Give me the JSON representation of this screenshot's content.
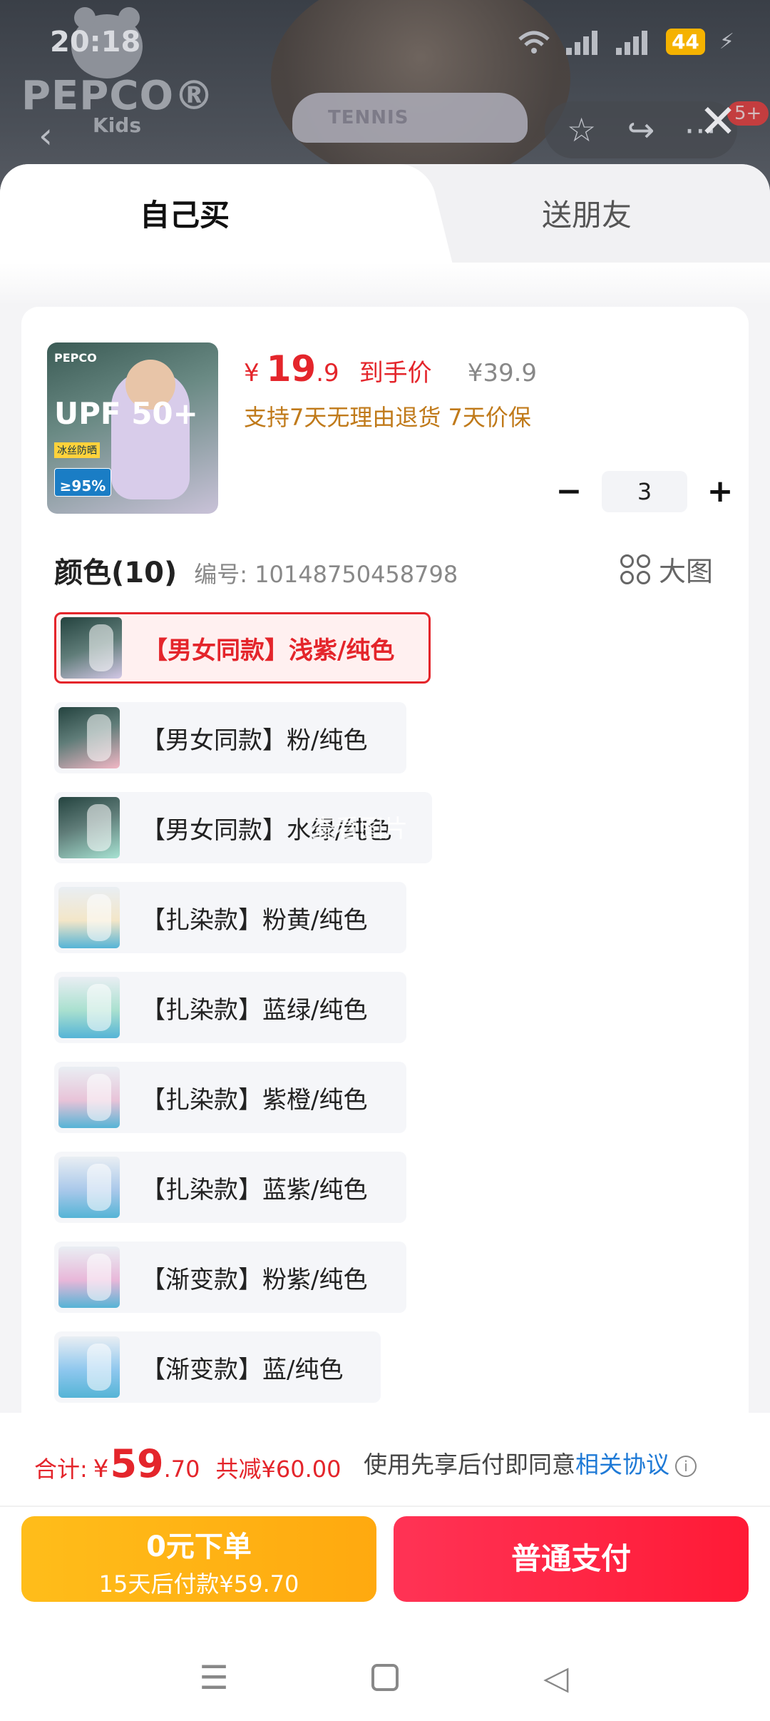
{
  "status_bar": {
    "time": "20:18",
    "battery": "44"
  },
  "brand": {
    "name": "PEPCO®",
    "sub": "Kids"
  },
  "backdrop_text": "TENNIS",
  "nav": {
    "badge": "5+"
  },
  "tabs": {
    "self_buy": "自己买",
    "gift": "送朋友"
  },
  "product": {
    "image_logo": "PEPCO",
    "image_upf": "UPF 50+",
    "image_tag1": "冰丝防晒",
    "image_tag2": "≥95%",
    "price_currency": "¥",
    "price_int": "19",
    "price_dec": ".9",
    "price_tag": "到手价",
    "price_old": "¥39.9",
    "service": "支持7天无理由退货  7天价保",
    "quantity": "3"
  },
  "section": {
    "title": "颜色(10)",
    "code": "编号: 10148750458798",
    "bigpic": "大图"
  },
  "options": [
    {
      "label": "【男女同款】浅紫/纯色",
      "selected": true
    },
    {
      "label": "【男女同款】粉/纯色"
    },
    {
      "label": "【男女同款】水绿/纯色"
    },
    {
      "label": "【扎染款】粉黄/纯色"
    },
    {
      "label": "【扎染款】蓝绿/纯色"
    },
    {
      "label": "【扎染款】紫橙/纯色"
    },
    {
      "label": "【扎染款】蓝紫/纯色"
    },
    {
      "label": "【渐变款】粉紫/纯色"
    },
    {
      "label": "【渐变款】蓝/纯色"
    }
  ],
  "overlay_tip": "查看图片",
  "footer": {
    "total_label": "合计:",
    "total_cur": "¥",
    "total_int": "59",
    "total_dec": ".70",
    "save": "共减¥60.00",
    "agree_prefix": "使用先享后付即同意",
    "agree_link": "相关协议",
    "btn_zero_l1": "0元下单",
    "btn_zero_l2": "15天后付款¥59.70",
    "btn_pay": "普通支付"
  },
  "colors": {
    "accent": "#e4252b",
    "gold": "#c07a1a",
    "link": "#1f7ad6"
  }
}
